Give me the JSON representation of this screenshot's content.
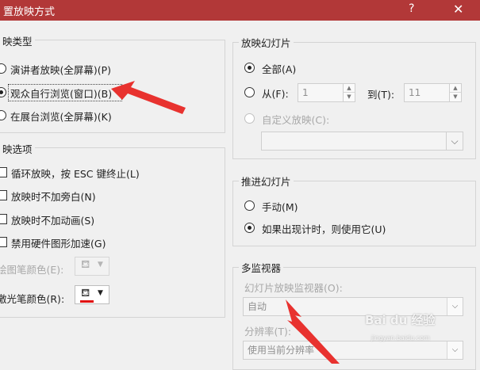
{
  "window": {
    "title": "置放映方式",
    "help": "?",
    "close": "✕"
  },
  "show_type": {
    "title": "映类型",
    "options": [
      {
        "label": "演讲者放映(全屏幕)(P)",
        "selected": false
      },
      {
        "label": "观众自行浏览(窗口)(B)",
        "selected": true
      },
      {
        "label": "在展台浏览(全屏幕)(K)",
        "selected": false
      }
    ]
  },
  "show_options": {
    "title": "映选项",
    "checks": [
      {
        "label": "循环放映，按 ESC 键终止(L)",
        "checked": false
      },
      {
        "label": "放映时不加旁白(N)",
        "checked": false
      },
      {
        "label": "放映时不加动画(S)",
        "checked": false
      },
      {
        "label": "禁用硬件图形加速(G)",
        "checked": false
      }
    ],
    "pen_color_label": "绘图笔颜色(E):",
    "laser_color_label": "激光笔颜色(R):",
    "laser_color": "#e01010"
  },
  "show_slides": {
    "title": "放映幻灯片",
    "all_label": "全部(A)",
    "from_label": "从(F):",
    "from_value": "1",
    "to_label": "到(T):",
    "to_value": "11",
    "custom_label": "自定义放映(C):",
    "custom_value": ""
  },
  "advance": {
    "title": "推进幻灯片",
    "manual_label": "手动(M)",
    "timings_label": "如果出现计时，则使用它(U)"
  },
  "monitors": {
    "title": "多监视器",
    "monitor_label": "幻灯片放映监视器(O):",
    "monitor_value": "自动",
    "resolution_label": "分辨率(T):",
    "resolution_value": "使用当前分辨率"
  },
  "watermark": {
    "brand": "Bai du 经验",
    "url": "jingyan.baidu.com"
  },
  "colors": {
    "title_bar": "#b23838",
    "annotation_arrow": "#e8322f"
  }
}
